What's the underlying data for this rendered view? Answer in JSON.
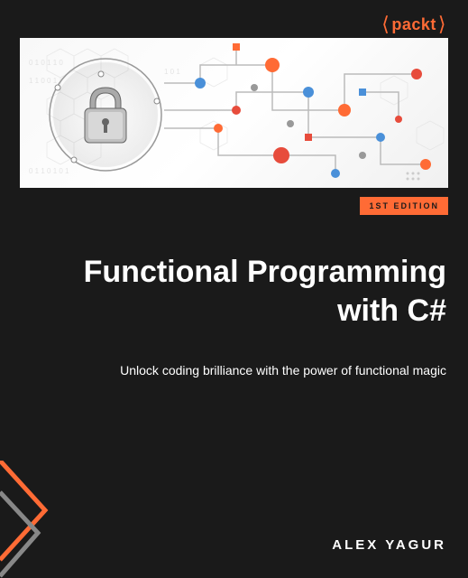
{
  "publisher": {
    "name": "packt",
    "angle_left": "⟨",
    "angle_right": "⟩"
  },
  "edition": "1ST EDITION",
  "title": "Functional Programming with C#",
  "subtitle": "Unlock coding brilliance with the power of functional magic",
  "author": "ALEX YAGUR",
  "colors": {
    "accent": "#ff6b35",
    "background": "#1a1a1a",
    "text": "#ffffff"
  }
}
